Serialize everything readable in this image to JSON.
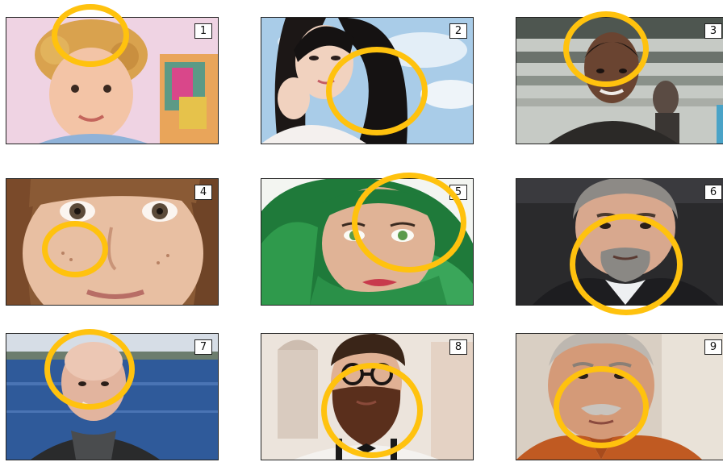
{
  "highlight_color": "#ffc20e",
  "tiles": [
    {
      "number": "1",
      "subject": "child-curly-blonde-hair",
      "highlight": "hair"
    },
    {
      "number": "2",
      "subject": "woman-long-dark-hair",
      "highlight": "hair"
    },
    {
      "number": "3",
      "subject": "young-man-short-hair",
      "highlight": "hair"
    },
    {
      "number": "4",
      "subject": "girl-freckles-closeup",
      "highlight": "cheek"
    },
    {
      "number": "5",
      "subject": "woman-green-headscarf",
      "highlight": "eye"
    },
    {
      "number": "6",
      "subject": "man-grey-goatee",
      "highlight": "beard"
    },
    {
      "number": "7",
      "subject": "bald-man-lakeside",
      "highlight": "head"
    },
    {
      "number": "8",
      "subject": "man-full-beard-glasses",
      "highlight": "beard"
    },
    {
      "number": "9",
      "subject": "older-man-mustache",
      "highlight": "mustache"
    }
  ]
}
